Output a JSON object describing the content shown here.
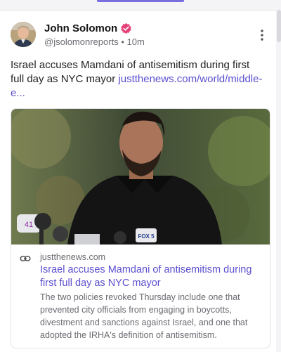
{
  "post": {
    "author_name": "John Solomon",
    "handle": "@jsolomonreports",
    "separator": "•",
    "time": "10m",
    "text": "Israel accuses Mamdani of antisemitism during first full day as NYC mayor ",
    "link_text": "justthenews.com/world/​middle-e...",
    "verified_color": "#e5427a",
    "accent": "#5b4fcf"
  },
  "preview": {
    "domain": "justthenews.com",
    "title": "Israel accuses Mamdani of antisemitism during first full day as NYC mayor",
    "description": "The two policies revoked Thursday include one that prevented city officials from engaging in boycotts, divestment and sanctions against Israel, and one that adopted the IRHA's definition of antisemitism.",
    "image_mic_logos": [
      "41",
      "FOX 5"
    ]
  },
  "icons": {
    "verified": "verified-badge-icon",
    "more": "more-vertical-icon",
    "link": "link-icon"
  }
}
